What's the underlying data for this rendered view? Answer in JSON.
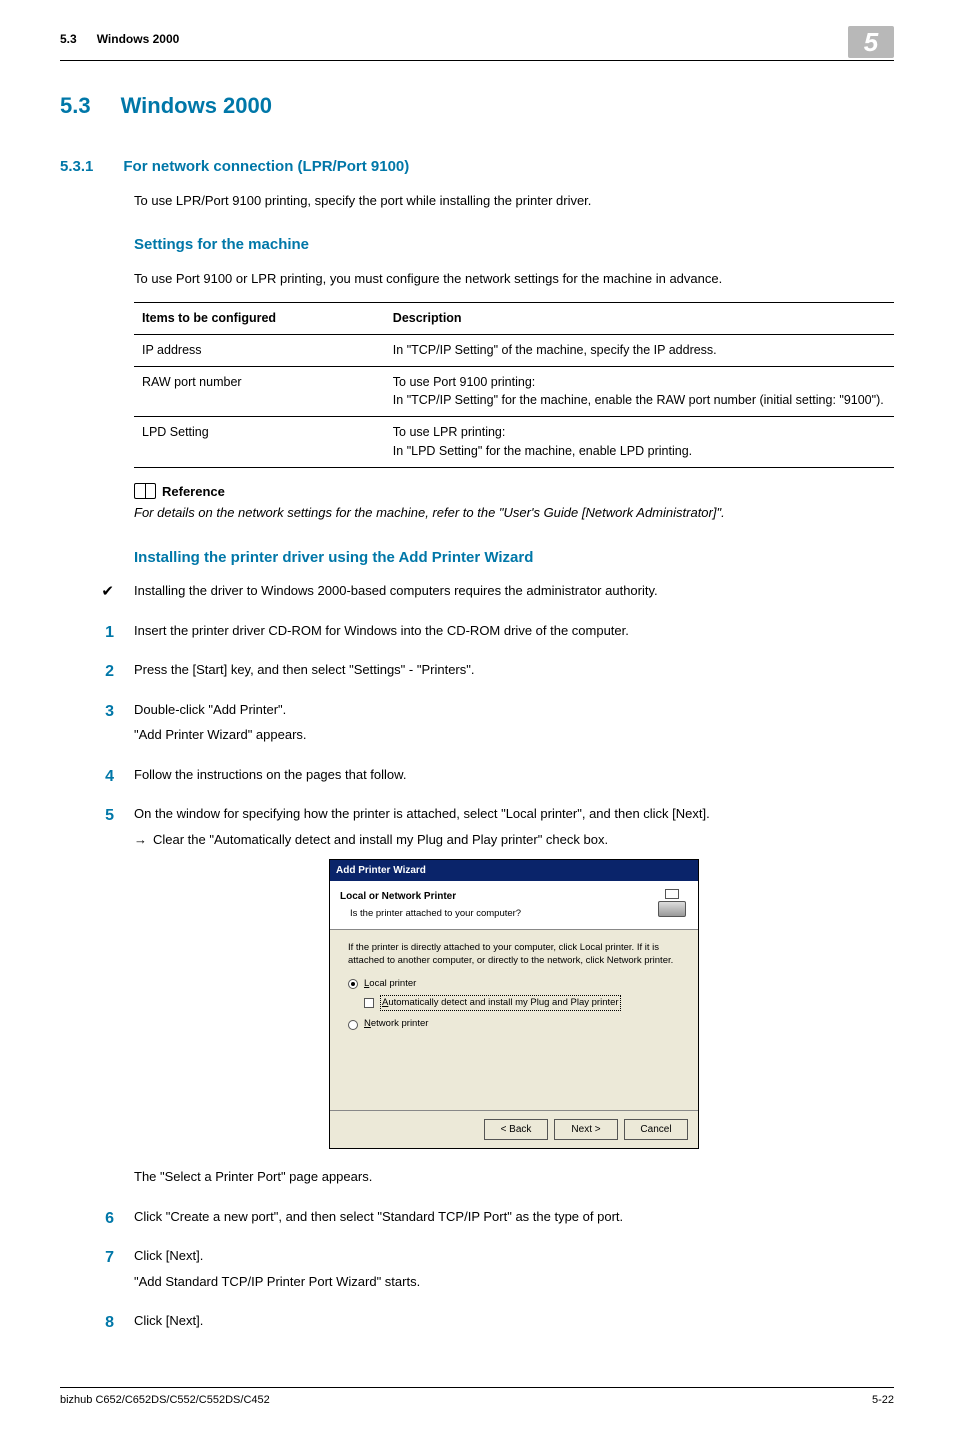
{
  "header": {
    "section_num": "5.3",
    "section_name": "Windows 2000",
    "chapter_badge": "5"
  },
  "section": {
    "number": "5.3",
    "title": "Windows 2000"
  },
  "subsection": {
    "number": "5.3.1",
    "title": "For network connection (LPR/Port 9100)",
    "intro": "To use LPR/Port 9100 printing, specify the port while installing the printer driver."
  },
  "settings_block": {
    "heading": "Settings for the machine",
    "intro": "To use Port 9100 or LPR printing, you must configure the network settings for the machine in advance.",
    "table": {
      "headers": [
        "Items to be configured",
        "Description"
      ],
      "rows": [
        {
          "item": "IP address",
          "desc": "In \"TCP/IP Setting\" of the machine, specify the IP address."
        },
        {
          "item": "RAW port number",
          "desc": "To use Port 9100 printing:\nIn \"TCP/IP Setting\" for the machine, enable the RAW port number (initial setting: \"9100\")."
        },
        {
          "item": "LPD Setting",
          "desc": "To use LPR printing:\n In \"LPD Setting\" for the machine, enable LPD printing."
        }
      ]
    },
    "reference_label": "Reference",
    "reference_text": "For details on the network settings for the machine, refer to the \"User's Guide [Network Administrator]\"."
  },
  "install_block": {
    "heading": "Installing the printer driver using the Add Printer Wizard",
    "prereq": "Installing the driver to Windows 2000-based computers requires the administrator authority.",
    "steps": [
      {
        "n": "1",
        "text": "Insert the printer driver CD-ROM for Windows into the CD-ROM drive of the computer."
      },
      {
        "n": "2",
        "text": "Press the [Start] key, and then select \"Settings\" - \"Printers\"."
      },
      {
        "n": "3",
        "text": "Double-click \"Add Printer\".",
        "after": "\"Add Printer Wizard\" appears."
      },
      {
        "n": "4",
        "text": "Follow the instructions on the pages that follow."
      },
      {
        "n": "5",
        "text": "On the window for specifying how the printer is attached, select \"Local printer\", and then click [Next].",
        "sub": "Clear the \"Automatically detect and install my Plug and Play printer\" check box.",
        "after_dialog": "The \"Select a Printer Port\" page appears."
      },
      {
        "n": "6",
        "text": "Click \"Create a new port\", and then select \"Standard TCP/IP Port\" as the type of port."
      },
      {
        "n": "7",
        "text": "Click [Next].",
        "after": "\"Add Standard TCP/IP Printer Port Wizard\" starts."
      },
      {
        "n": "8",
        "text": "Click [Next]."
      }
    ]
  },
  "dialog": {
    "title": "Add Printer Wizard",
    "head_bold": "Local or Network Printer",
    "head_sub": "Is the printer attached to your computer?",
    "intro": "If the printer is directly attached to your computer, click Local printer. If it is attached to another computer, or directly to the network, click Network printer.",
    "opt_local_pre": "L",
    "opt_local_rest": "ocal printer",
    "opt_auto_pre": "A",
    "opt_auto_rest": "utomatically detect and install my Plug and Play printer",
    "opt_network_pre": "N",
    "opt_network_rest": "etwork printer",
    "btn_back": "< Back",
    "btn_next": "Next >",
    "btn_cancel": "Cancel"
  },
  "footer": {
    "left": "bizhub C652/C652DS/C552/C552DS/C452",
    "right": "5-22"
  }
}
